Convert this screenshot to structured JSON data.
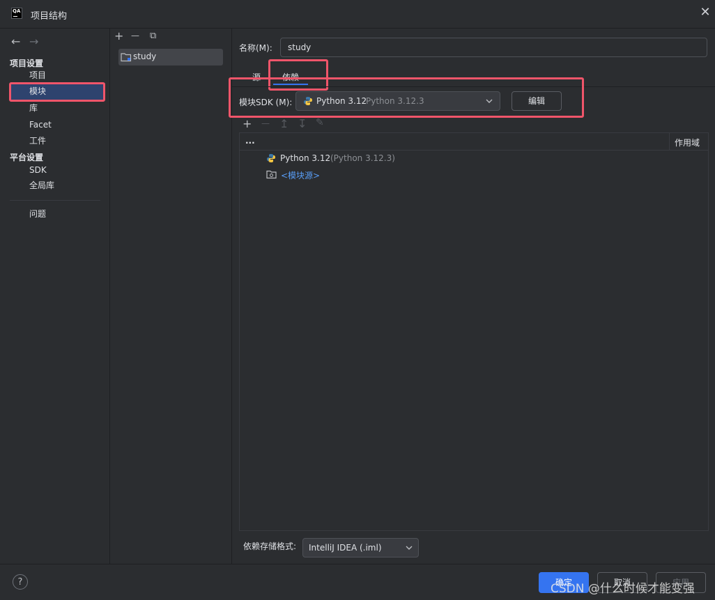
{
  "window": {
    "title": "项目结构",
    "close": "✕",
    "app_icon_text": "QA"
  },
  "nav": {
    "back": "←",
    "forward": "→",
    "group_project": "项目设置",
    "items_project": [
      "项目",
      "模块",
      "库",
      "Facet",
      "工件"
    ],
    "selected": "模块",
    "group_platform": "平台设置",
    "items_platform": [
      "SDK",
      "全局库"
    ],
    "problems": "问题"
  },
  "modules": {
    "toolbar": {
      "add": "+",
      "remove": "—",
      "copy": "⧉"
    },
    "items": [
      {
        "name": "study"
      }
    ]
  },
  "details": {
    "name_label": "名称(M):",
    "name_value": "study",
    "tabs": [
      "源",
      "依赖"
    ],
    "active_tab": "依赖",
    "sdk_label": "模块SDK (M):",
    "sdk_name": "Python 3.12",
    "sdk_version": "Python 3.12.3",
    "edit_button": "编辑",
    "deps_toolbar": {
      "add": "+",
      "remove": "—",
      "up": "↥",
      "down": "↧",
      "edit": "✎"
    },
    "table_columns": [
      "...",
      "作用域"
    ],
    "dependencies": [
      {
        "name": "Python 3.12",
        "detail": "(Python 3.12.3)",
        "icon": "python-icon"
      },
      {
        "name": "<模块源>",
        "detail": "",
        "icon": "module-source-folder-icon"
      }
    ],
    "storage_label": "依赖存储格式:",
    "storage_value": "IntelliJ IDEA (.iml)"
  },
  "footer": {
    "help": "?",
    "ok": "确定",
    "cancel": "取消",
    "apply": "应用"
  },
  "watermark": "CSDN @什么时候才能变强",
  "colors": {
    "accent": "#3574f0",
    "highlight_box": "#f0556a",
    "selected_nav": "#2e436e",
    "background": "#2b2d30"
  }
}
